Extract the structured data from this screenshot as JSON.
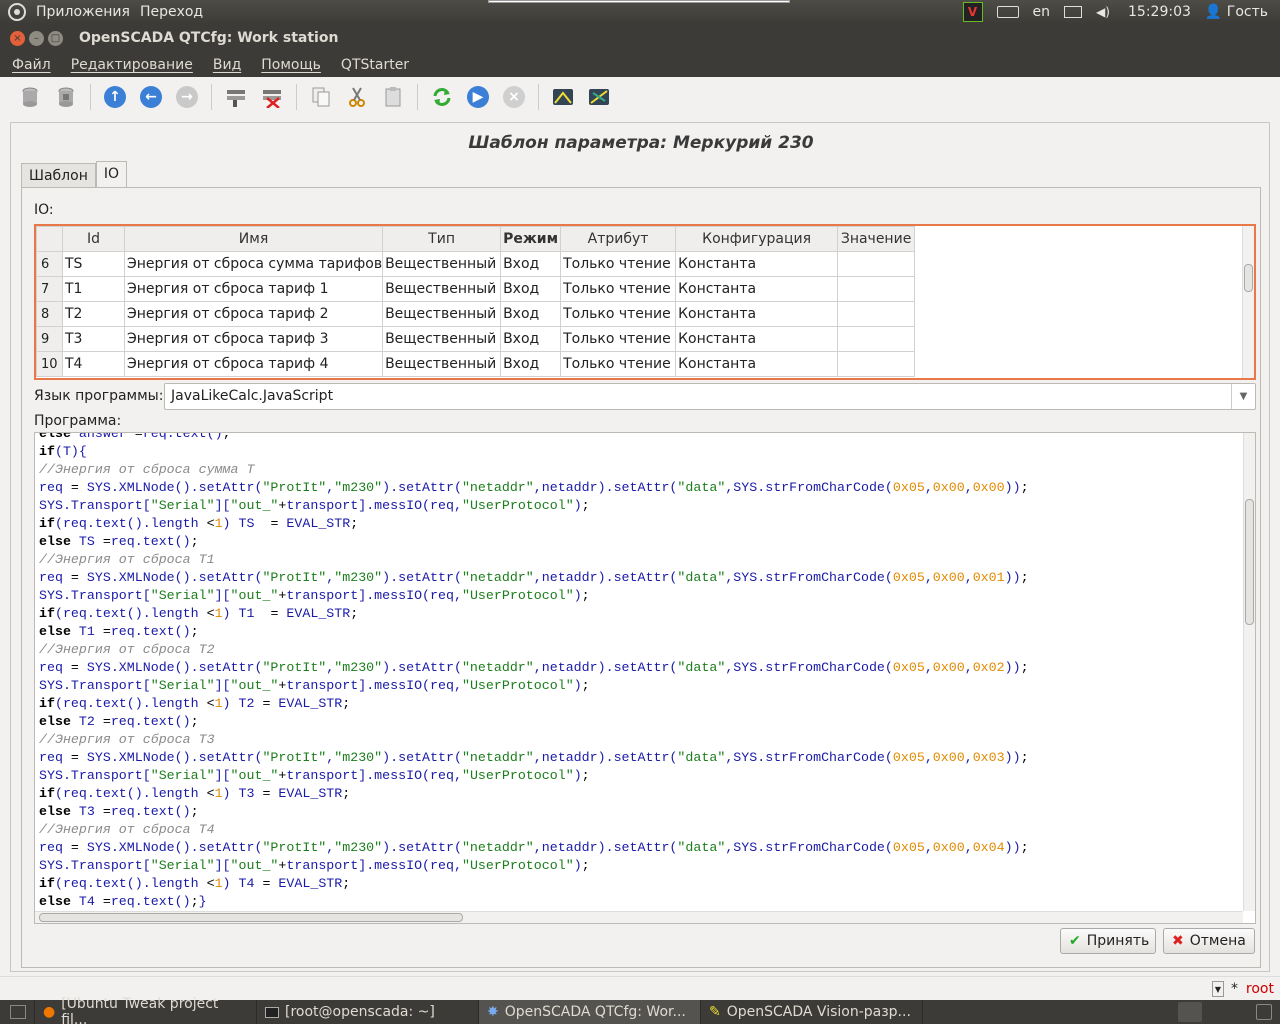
{
  "topbar": {
    "menus": [
      "Приложения",
      "Переход"
    ],
    "lang": "en",
    "time": "15:29:03",
    "user": "Гость"
  },
  "window": {
    "title": "OpenSCADA QTCfg: Work station"
  },
  "menubar": {
    "items": [
      "Файл",
      "Редактирование",
      "Вид",
      "Помощь",
      "QTStarter"
    ]
  },
  "toolbar": {
    "icons": [
      "db-load-icon",
      "db-save-icon",
      "up-icon",
      "back-icon",
      "forward-icon",
      "add-item-icon",
      "delete-item-icon",
      "copy-icon",
      "cut-icon",
      "paste-icon",
      "refresh-icon",
      "start-icon",
      "stop-icon",
      "vision-icon",
      "vision-dev-icon"
    ]
  },
  "page": {
    "title": "Шаблон параметра: Меркурий 230",
    "tabs": [
      "Шаблон",
      "IO"
    ],
    "active_tab": "IO",
    "io_label": "IO:",
    "table": {
      "headers": [
        "Id",
        "Имя",
        "Тип",
        "Режим",
        "Атрибут",
        "Конфигурация",
        "Значение"
      ],
      "rows": [
        {
          "n": "6",
          "id": "TS",
          "name": "Энергия от сброса сумма тарифов",
          "type": "Вещественный",
          "mode": "Вход",
          "attr": "Только чтение",
          "conf": "Константа",
          "val": ""
        },
        {
          "n": "7",
          "id": "T1",
          "name": "Энергия от сброса тариф 1",
          "type": "Вещественный",
          "mode": "Вход",
          "attr": "Только чтение",
          "conf": "Константа",
          "val": ""
        },
        {
          "n": "8",
          "id": "T2",
          "name": "Энергия от сброса тариф 2",
          "type": "Вещественный",
          "mode": "Вход",
          "attr": "Только чтение",
          "conf": "Константа",
          "val": ""
        },
        {
          "n": "9",
          "id": "T3",
          "name": "Энергия от сброса тариф 3",
          "type": "Вещественный",
          "mode": "Вход",
          "attr": "Только чтение",
          "conf": "Константа",
          "val": ""
        },
        {
          "n": "10",
          "id": "T4",
          "name": "Энергия от сброса тариф 4",
          "type": "Вещественный",
          "mode": "Вход",
          "attr": "Только чтение",
          "conf": "Константа",
          "val": ""
        }
      ]
    },
    "lang_label": "Язык программы:",
    "lang_value": "JavaLikeCalc.JavaScript",
    "program_label": "Программа:",
    "program_lines": [
      "else answer =req.text();",
      "if(T){",
      "//Энергия от сброса сумма T",
      "req = SYS.XMLNode().setAttr(\"ProtIt\",\"m230\").setAttr(\"netaddr\",netaddr).setAttr(\"data\",SYS.strFromCharCode(0x05,0x00,0x00));",
      "SYS.Transport[\"Serial\"][\"out_\"+transport].messIO(req,\"UserProtocol\");",
      "if(req.text().length <1) TS  = EVAL_STR;",
      "else TS =req.text();",
      "//Энергия от сброса T1",
      "req = SYS.XMLNode().setAttr(\"ProtIt\",\"m230\").setAttr(\"netaddr\",netaddr).setAttr(\"data\",SYS.strFromCharCode(0x05,0x00,0x01));",
      "SYS.Transport[\"Serial\"][\"out_\"+transport].messIO(req,\"UserProtocol\");",
      "if(req.text().length <1) T1  = EVAL_STR;",
      "else T1 =req.text();",
      "//Энергия от сброса T2",
      "req = SYS.XMLNode().setAttr(\"ProtIt\",\"m230\").setAttr(\"netaddr\",netaddr).setAttr(\"data\",SYS.strFromCharCode(0x05,0x00,0x02));",
      "SYS.Transport[\"Serial\"][\"out_\"+transport].messIO(req,\"UserProtocol\");",
      "if(req.text().length <1) T2 = EVAL_STR;",
      "else T2 =req.text();",
      "//Энергия от сброса T3",
      "req = SYS.XMLNode().setAttr(\"ProtIt\",\"m230\").setAttr(\"netaddr\",netaddr).setAttr(\"data\",SYS.strFromCharCode(0x05,0x00,0x03));",
      "SYS.Transport[\"Serial\"][\"out_\"+transport].messIO(req,\"UserProtocol\");",
      "if(req.text().length <1) T3 = EVAL_STR;",
      "else T3 =req.text();",
      "//Энергия от сброса T4",
      "req = SYS.XMLNode().setAttr(\"ProtIt\",\"m230\").setAttr(\"netaddr\",netaddr).setAttr(\"data\",SYS.strFromCharCode(0x05,0x00,0x04));",
      "SYS.Transport[\"Serial\"][\"out_\"+transport].messIO(req,\"UserProtocol\");",
      "if(req.text().length <1) T4 = EVAL_STR;",
      "else T4 =req.text();}"
    ],
    "accept_label": "Принять",
    "cancel_label": "Отмена"
  },
  "statusbar": {
    "mark": "*",
    "user": "root"
  },
  "taskbar": {
    "items": [
      {
        "label": "[Ubuntu Tweak project fil...",
        "icon": "firefox-icon",
        "active": false
      },
      {
        "label": "[root@openscada: ~]",
        "icon": "terminal-icon",
        "active": false
      },
      {
        "label": "OpenSCADA QTCfg: Wor...",
        "icon": "openscada-icon",
        "active": true
      },
      {
        "label": "OpenSCADA Vision-разр...",
        "icon": "vision-icon",
        "active": false
      }
    ]
  },
  "colors": {
    "accent_border": "#e8774a",
    "code_keyword": "#000000",
    "code_ident": "#1a1aa8",
    "code_string": "#1c7d1c",
    "code_number": "#e08a00",
    "code_comment": "#8a8a8a"
  }
}
